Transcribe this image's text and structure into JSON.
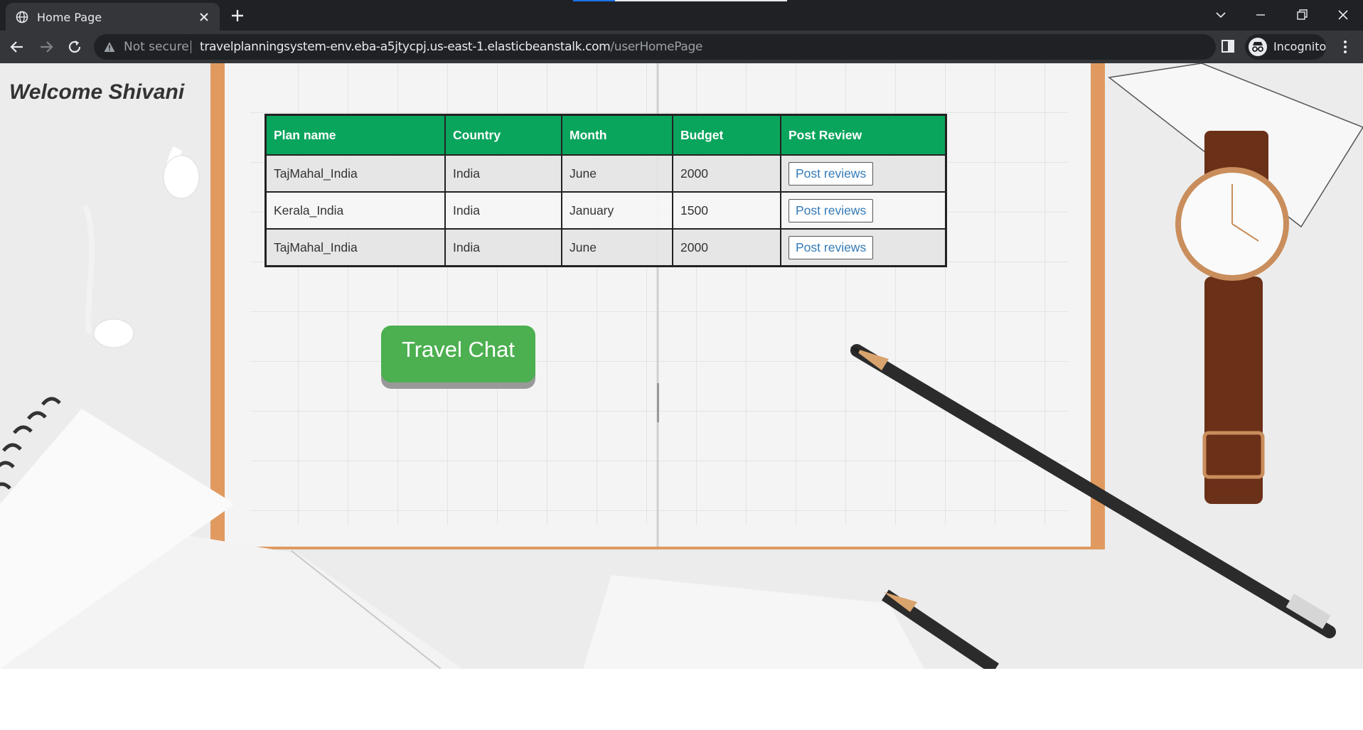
{
  "browser": {
    "tab_title": "Home Page",
    "security_label": "Not secure",
    "url_host": "travelplanningsystem-env.eba-a5jtycpj.us-east-1.elasticbeanstalk.com",
    "url_path": "/userHomePage",
    "profile_label": "Incognito"
  },
  "page": {
    "welcome": "Welcome Shivani",
    "table": {
      "headers": [
        "Plan name",
        "Country",
        "Month",
        "Budget",
        "Post Review"
      ],
      "rows": [
        {
          "plan": "TajMahal_India",
          "country": "India",
          "month": "June",
          "budget": "2000",
          "action": "Post reviews"
        },
        {
          "plan": "Kerala_India",
          "country": "India",
          "month": "January",
          "budget": "1500",
          "action": "Post reviews"
        },
        {
          "plan": "TajMahal_India",
          "country": "India",
          "month": "June",
          "budget": "2000",
          "action": "Post reviews"
        }
      ]
    },
    "chat_button": "Travel Chat"
  },
  "colors": {
    "header_green": "#0aa55c",
    "chat_button_green": "#4caf50",
    "link_blue": "#337ab7",
    "chrome_dark": "#202124",
    "chrome_toolbar": "#35363a"
  }
}
